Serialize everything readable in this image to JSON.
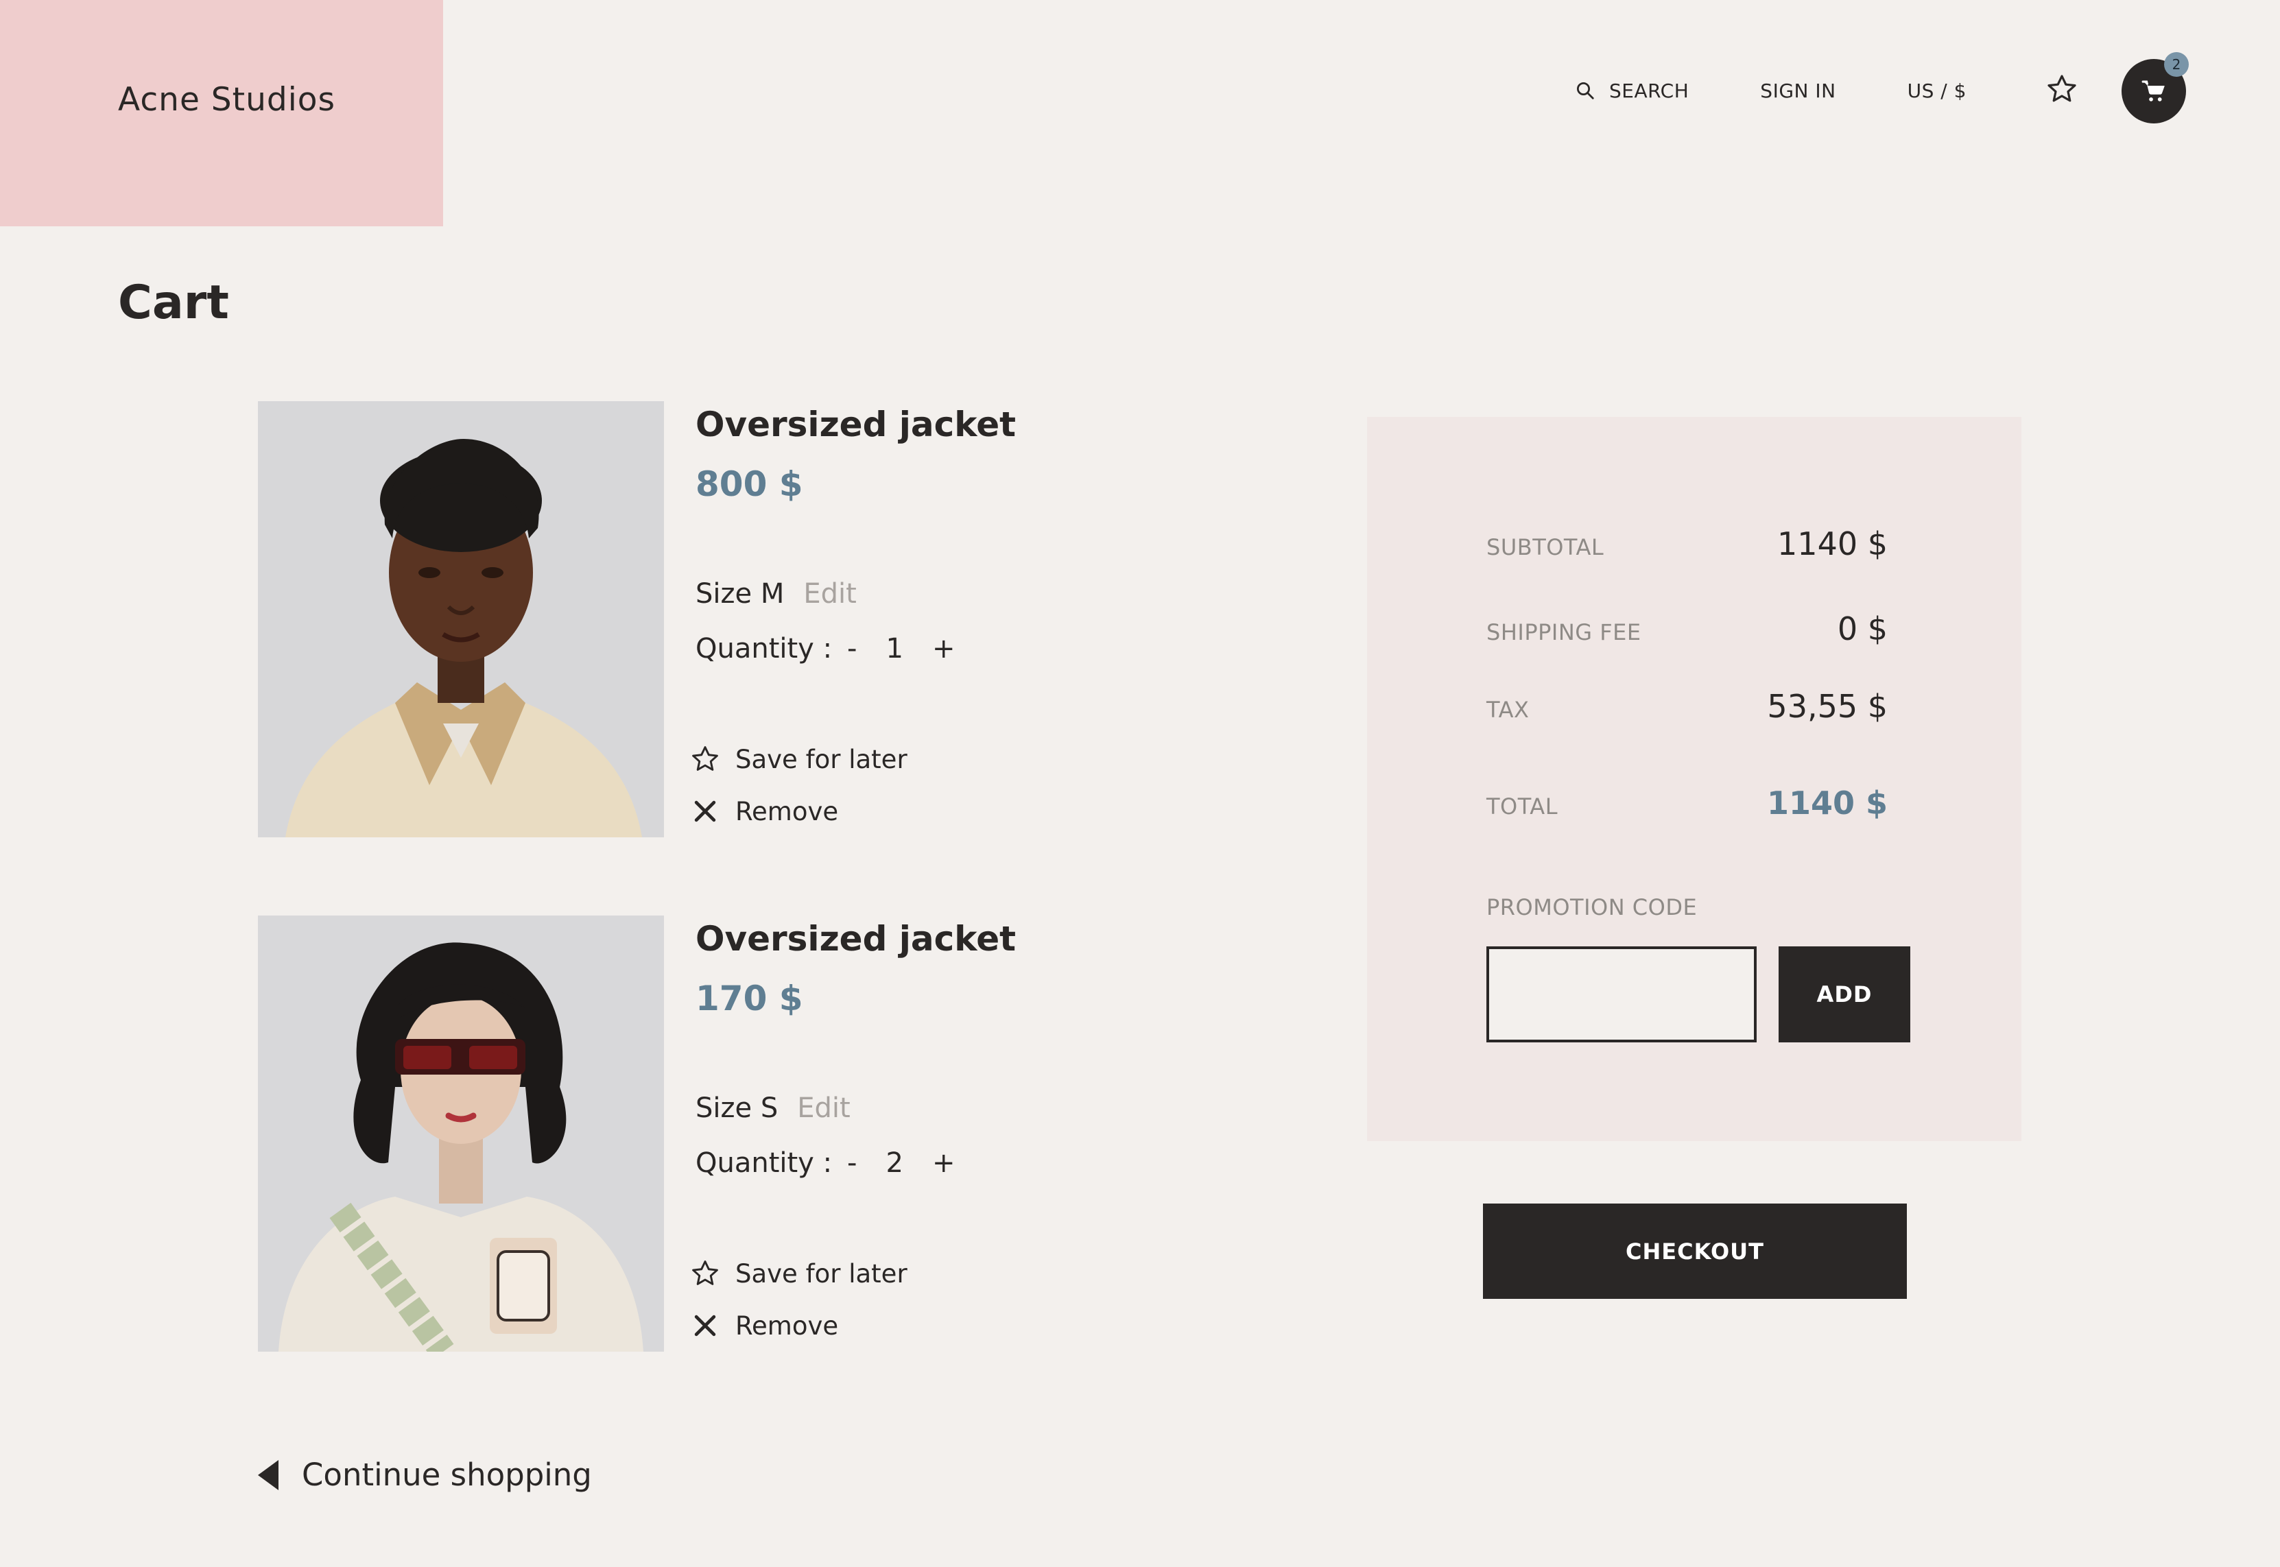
{
  "brand": {
    "name": "Acne Studios"
  },
  "nav": {
    "search_label": "SEARCH",
    "signin_label": "SIGN IN",
    "region_label": "US / $",
    "favorites_icon": "star-icon",
    "cart_icon": "shopping-cart-icon",
    "cart_count": "2"
  },
  "page": {
    "title": "Cart"
  },
  "items": [
    {
      "name": "Oversized jacket",
      "price": "800 $",
      "size": "Size M",
      "edit_label": "Edit",
      "quantity_label": "Quantity :",
      "minus": "-",
      "quantity": "1",
      "plus": "+",
      "save_label": "Save for later",
      "remove_label": "Remove"
    },
    {
      "name": "Oversized jacket",
      "price": "170 $",
      "size": "Size S",
      "edit_label": "Edit",
      "quantity_label": "Quantity :",
      "minus": "-",
      "quantity": "2",
      "plus": "+",
      "save_label": "Save for later",
      "remove_label": "Remove"
    }
  ],
  "summary": {
    "subtotal_label": "SUBTOTAL",
    "subtotal_value": "1140  $",
    "shipping_label": "SHIPPING FEE",
    "shipping_value": "0  $",
    "tax_label": "TAX",
    "tax_value": "53,55  $",
    "total_label": "TOTAL",
    "total_value": "1140  $",
    "promo_label": "PROMOTION CODE",
    "promo_value": "",
    "promo_button": "ADD"
  },
  "checkout_label": "CHECKOUT",
  "continue_label": "Continue shopping",
  "colors": {
    "background": "#f3f0ed",
    "logo_block": "#efcdcd",
    "summary_panel": "#f0e7e5",
    "accent_price": "#5f7e92",
    "dark": "#2a2726",
    "badge": "#7a95a8"
  }
}
